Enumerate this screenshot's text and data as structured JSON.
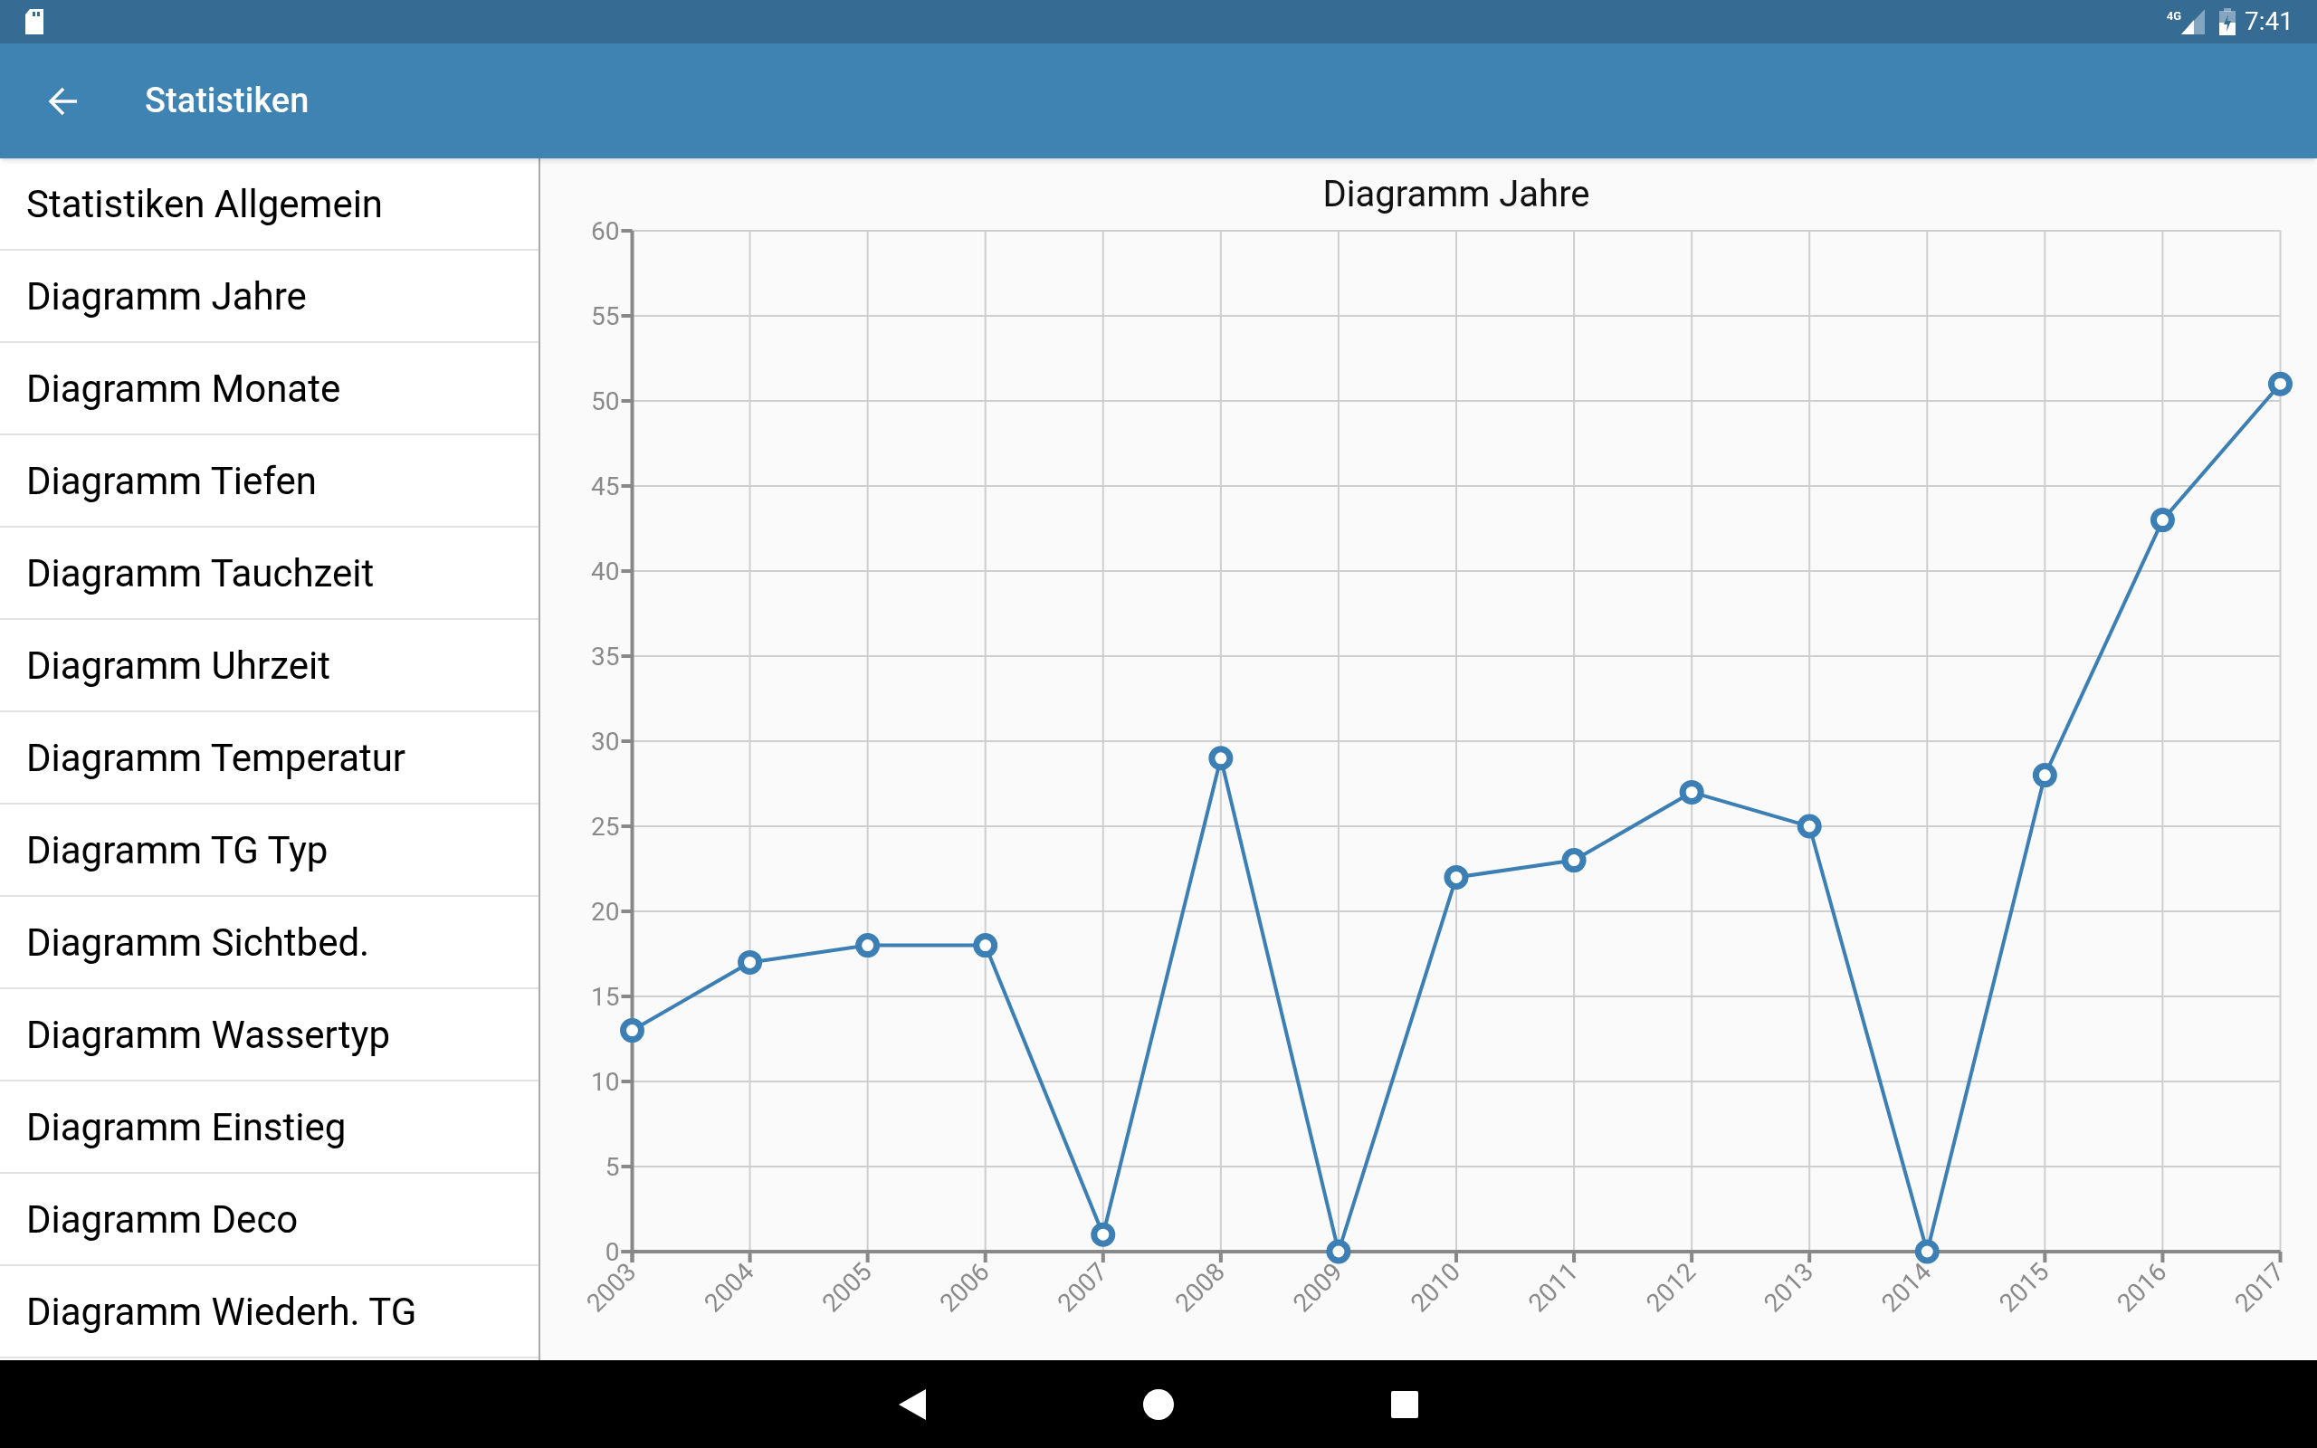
{
  "status_bar": {
    "network": "4G",
    "time": "7:41"
  },
  "app_bar": {
    "title": "Statistiken"
  },
  "sidebar": {
    "items": [
      {
        "label": "Statistiken Allgemein"
      },
      {
        "label": "Diagramm Jahre"
      },
      {
        "label": "Diagramm Monate"
      },
      {
        "label": "Diagramm Tiefen"
      },
      {
        "label": "Diagramm Tauchzeit"
      },
      {
        "label": "Diagramm Uhrzeit"
      },
      {
        "label": "Diagramm Temperatur"
      },
      {
        "label": "Diagramm TG Typ"
      },
      {
        "label": "Diagramm Sichtbed."
      },
      {
        "label": "Diagramm Wassertyp"
      },
      {
        "label": "Diagramm Einstieg"
      },
      {
        "label": "Diagramm Deco"
      },
      {
        "label": "Diagramm Wiederh. TG"
      }
    ]
  },
  "chart": {
    "chart_data": {
      "type": "line",
      "title": "Diagramm Jahre",
      "categories": [
        "2003",
        "2004",
        "2005",
        "2006",
        "2007",
        "2008",
        "2009",
        "2010",
        "2011",
        "2012",
        "2013",
        "2014",
        "2015",
        "2016",
        "2017"
      ],
      "grid": true,
      "series": [
        {
          "color": "#3b7fb5",
          "marker": "circle",
          "values": [
            13,
            17,
            18,
            18,
            1,
            29,
            0,
            22,
            23,
            27,
            25,
            0,
            28,
            43,
            51
          ]
        }
      ],
      "ylim": [
        0,
        60
      ],
      "yticks": [
        0,
        5,
        10,
        15,
        20,
        25,
        30,
        35,
        40,
        45,
        50,
        55,
        60
      ]
    }
  }
}
